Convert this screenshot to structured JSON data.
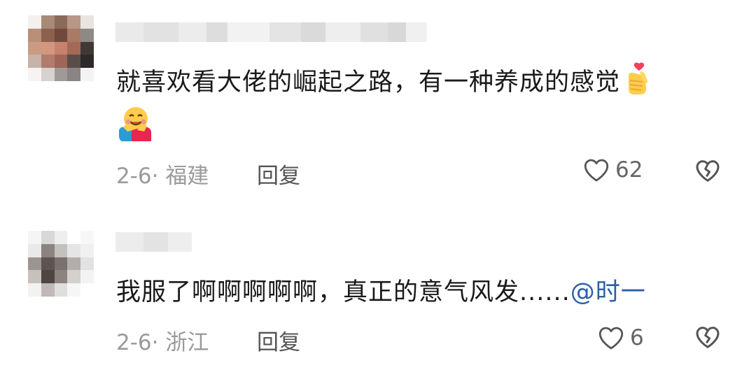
{
  "comments": [
    {
      "text": "就喜欢看大佬的崛起之路，有一种养成的感觉",
      "date_location": "2-6· 福建",
      "reply_label": "回复",
      "likes": "62",
      "emojis": [
        "heart-hands-emoji",
        "hugging-face-emoji"
      ]
    },
    {
      "text": "我服了啊啊啊啊啊，真正的意气风发......",
      "mention": "@时一",
      "date_location": "2-6· 浙江",
      "reply_label": "回复",
      "likes": "6"
    }
  ],
  "colors": {
    "text": "#1a1a1a",
    "meta": "#9a9a9a",
    "mention": "#2b5fa8",
    "icon": "#555555"
  }
}
